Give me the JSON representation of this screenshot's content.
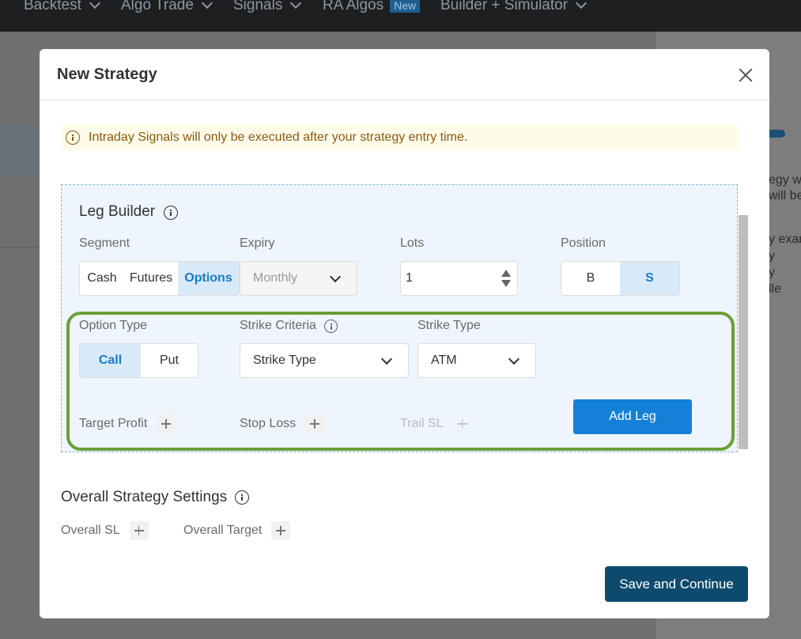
{
  "topnav": {
    "items": [
      {
        "label": "Backtest"
      },
      {
        "label": "Algo Trade"
      },
      {
        "label": "Signals"
      },
      {
        "label": "RA Algos",
        "badge": "New"
      },
      {
        "label": "Builder + Simulator"
      }
    ]
  },
  "background": {
    "text_lines": [
      "egy w",
      "will be",
      "y exar",
      "y",
      "y",
      "lle"
    ]
  },
  "modal": {
    "title": "New Strategy",
    "alert": "Intraday Signals will only be executed after your strategy entry time.",
    "leg_builder": {
      "title": "Leg Builder",
      "segment": {
        "label": "Segment",
        "options": [
          "Cash",
          "Futures",
          "Options"
        ],
        "selected": "Options"
      },
      "expiry": {
        "label": "Expiry",
        "value": "Monthly"
      },
      "lots": {
        "label": "Lots",
        "value": "1"
      },
      "position": {
        "label": "Position",
        "options": [
          "B",
          "S"
        ],
        "selected": "S"
      },
      "option_type": {
        "label": "Option Type",
        "options": [
          "Call",
          "Put"
        ],
        "selected": "Call"
      },
      "strike_criteria": {
        "label": "Strike Criteria",
        "value": "Strike Type"
      },
      "strike_type": {
        "label": "Strike Type",
        "value": "ATM"
      },
      "target_profit": "Target Profit",
      "stop_loss": "Stop Loss",
      "trail_sl": "Trail SL",
      "add_leg": "Add Leg"
    },
    "overall": {
      "title": "Overall Strategy Settings",
      "overall_sl": "Overall SL",
      "overall_target": "Overall Target"
    },
    "save_button": "Save and Continue"
  },
  "colors": {
    "primary": "#1580d8",
    "dark_button": "#0e4a6e",
    "highlight": "#6a9f35",
    "alert_bg": "#fffbe9"
  }
}
